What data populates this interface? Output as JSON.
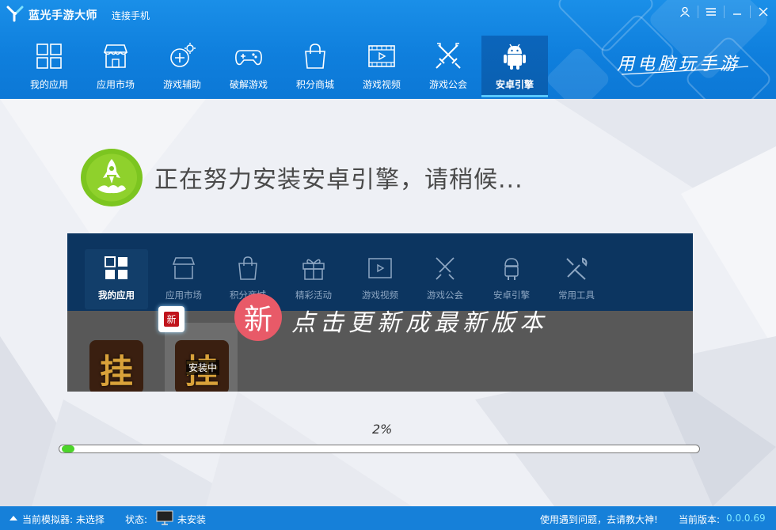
{
  "app": {
    "title": "蓝光手游大师",
    "connect_phone": "连接手机",
    "slogan": "用电脑玩手游"
  },
  "nav": {
    "items": [
      {
        "label": "我的应用",
        "icon": "grid-icon"
      },
      {
        "label": "应用市场",
        "icon": "store-icon"
      },
      {
        "label": "游戏辅助",
        "icon": "game-assist-icon"
      },
      {
        "label": "破解游戏",
        "icon": "gamepad-icon"
      },
      {
        "label": "积分商城",
        "icon": "shopping-bag-icon"
      },
      {
        "label": "游戏视频",
        "icon": "video-icon"
      },
      {
        "label": "游戏公会",
        "icon": "crossed-swords-icon"
      },
      {
        "label": "安卓引擎",
        "icon": "android-icon"
      }
    ],
    "active_index": 7
  },
  "main": {
    "install_message": "正在努力安装安卓引擎，请稍候...",
    "preview": {
      "nav_items": [
        "我的应用",
        "应用市场",
        "积分商城",
        "精彩活动",
        "游戏视频",
        "游戏公会",
        "安卓引擎",
        "常用工具"
      ],
      "new_tag": "新",
      "new_circle": "新",
      "update_text": "点击更新成最新版本",
      "tile_glyph": "挂",
      "installing": "安装中"
    },
    "progress": {
      "percent_label": "2%",
      "value": 0.02
    }
  },
  "status": {
    "emulator": "当前模拟器: 未选择",
    "state_label": "状态:",
    "state_value": "未安装",
    "help": "使用遇到问题，去请教大神!",
    "version_label": "当前版本:",
    "version_value": "0.0.0.69"
  },
  "colors": {
    "title_blue": "#1a8fe8",
    "active_tab": "#0a5fb0",
    "progress_green": "#4cd42a",
    "rocket_green": "#7cc520",
    "new_red": "#e85a68",
    "statusbar": "#1680d9"
  }
}
